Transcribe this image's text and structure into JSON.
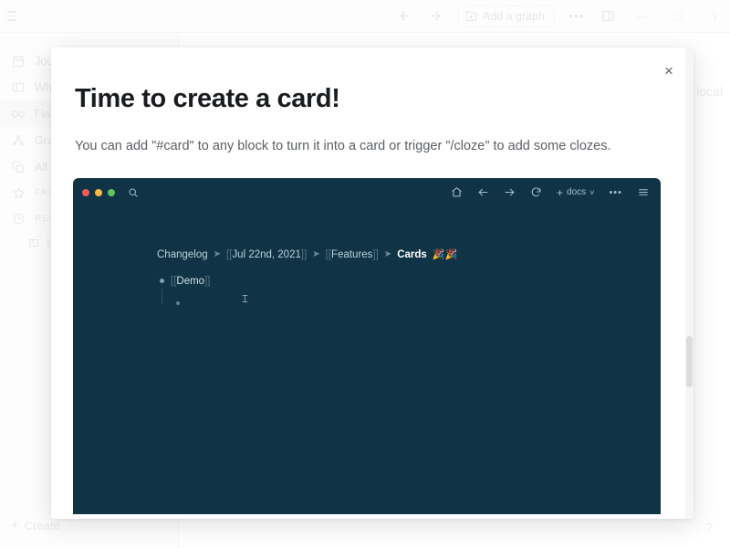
{
  "app": {
    "toolbar": {
      "back_icon": "arrow-left-icon",
      "forward_icon": "arrow-right-icon",
      "add_graph_label": "Add a graph",
      "add_graph_icon": "folder-plus-icon",
      "more_label": "•••",
      "sidebar_toggle_icon": "right-sidebar-icon",
      "minimize_label": "—",
      "maximize_label": "□",
      "expand_label": "›",
      "menu_icon": "hamburger-menu-icon"
    },
    "sidebar": {
      "items": [
        {
          "label": "Journals",
          "icon": "calendar-icon",
          "active": false
        },
        {
          "label": "Whiteboards",
          "icon": "whiteboard-icon",
          "active": false
        },
        {
          "label": "Flashcards",
          "icon": "infinity-icon",
          "active": true
        },
        {
          "label": "Graph view",
          "icon": "graph-icon",
          "active": false
        },
        {
          "label": "All pages",
          "icon": "pages-icon",
          "active": false
        }
      ],
      "sections": [
        {
          "label": "FAVORITES",
          "icon": "star-icon"
        },
        {
          "label": "RECENT",
          "icon": "clock-icon"
        }
      ],
      "recent_item": {
        "label": "Untitled",
        "icon": "page-icon"
      },
      "create_label": "Create",
      "create_icon": "plus-icon"
    },
    "main": {
      "local_label": "local",
      "help_label": "?"
    }
  },
  "modal": {
    "close_icon": "close-icon",
    "close_label": "×",
    "title": "Time to create a card!",
    "subtitle": "You can add \"#card\" to any block to turn it into a card or trigger \"/cloze\" to add some clozes.",
    "demo": {
      "titlebar": {
        "traffic_lights": [
          "#f05b56",
          "#f3bb44",
          "#5fc558"
        ],
        "search_icon": "search-icon",
        "home_icon": "home-icon",
        "back_icon": "arrow-left-icon",
        "forward_icon": "arrow-right-icon",
        "refresh_icon": "refresh-icon",
        "docs_label": "docs",
        "docs_plus": "+",
        "docs_caret": "˅",
        "more_label": "•••",
        "menu_icon": "hamburger-menu-icon"
      },
      "breadcrumb": [
        {
          "text": "Changelog",
          "type": "plain"
        },
        {
          "text": "Jul 22nd, 2021",
          "type": "ref"
        },
        {
          "text": "Features",
          "type": "ref"
        },
        {
          "text": "Cards",
          "type": "current",
          "emoji": "🎉🎉"
        }
      ],
      "breadcrumb_separator": "➤",
      "bracket_open": "[[",
      "bracket_close": "]]",
      "bullets": [
        {
          "text": "Demo",
          "is_ref": true,
          "nested": false
        },
        {
          "text": "",
          "is_ref": false,
          "nested": true
        }
      ],
      "caret_glyph": "⌶",
      "background_color": "#103445"
    },
    "scrollbar": {
      "visible": true
    }
  }
}
